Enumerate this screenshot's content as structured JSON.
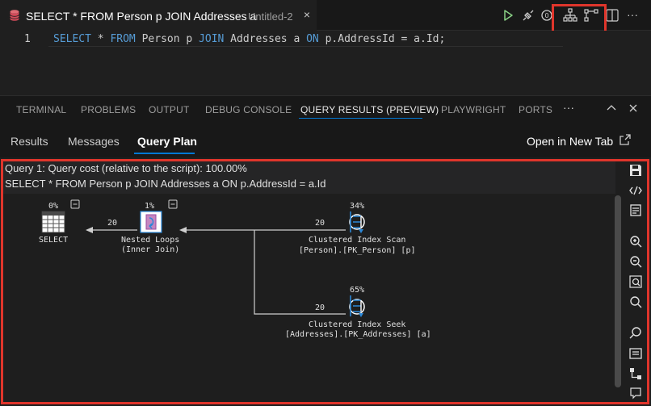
{
  "tab": {
    "title": "SELECT * FROM Person p JOIN Addresses a",
    "subtitle": "Untitled-2",
    "close": "×"
  },
  "toolbar": {
    "more": "···",
    "icons": [
      "run-icon",
      "debug-plug-icon",
      "estimated-plan-icon",
      "actual-plan-icon",
      "split-editor-icon"
    ]
  },
  "editor": {
    "line_number": "1",
    "tokens": [
      {
        "text": "SELECT",
        "kw": true
      },
      {
        "text": " * ",
        "kw": false
      },
      {
        "text": "FROM",
        "kw": true
      },
      {
        "text": " Person p ",
        "kw": false
      },
      {
        "text": "JOIN",
        "kw": true
      },
      {
        "text": " Addresses a ",
        "kw": false
      },
      {
        "text": "ON",
        "kw": true
      },
      {
        "text": " p.AddressId = a.Id;",
        "kw": false
      }
    ]
  },
  "panel": {
    "tabs": [
      "TERMINAL",
      "PROBLEMS",
      "OUTPUT",
      "DEBUG CONSOLE",
      "QUERY RESULTS (PREVIEW)",
      "PLAYWRIGHT",
      "PORTS"
    ],
    "more": "···",
    "subtabs": [
      "Results",
      "Messages",
      "Query Plan"
    ],
    "open_in_new_tab": "Open in New Tab"
  },
  "plan": {
    "query_cost": "Query 1: Query cost (relative to the script): 100.00%",
    "query_text": "SELECT * FROM Person p JOIN Addresses a ON p.AddressId = a.Id",
    "nodes": {
      "select": {
        "cost": "0%",
        "label": "SELECT"
      },
      "nested": {
        "cost": "1%",
        "label1": "Nested Loops",
        "label2": "(Inner Join)"
      },
      "scan": {
        "cost": "34%",
        "label1": "Clustered Index Scan",
        "label2": "[Person].[PK_Person] [p]"
      },
      "seek": {
        "cost": "65%",
        "label1": "Clustered Index Seek",
        "label2": "[Addresses].[PK_Addresses] [a]"
      }
    },
    "rows": {
      "to_select": "20",
      "scan_to_nested": "20",
      "seek_to_nested": "20"
    },
    "collapse": "−"
  },
  "colors": {
    "accent": "#0078d4",
    "highlight": "#e0352b",
    "keyword": "#569cd6",
    "plan_icon": "#2b88d8"
  }
}
